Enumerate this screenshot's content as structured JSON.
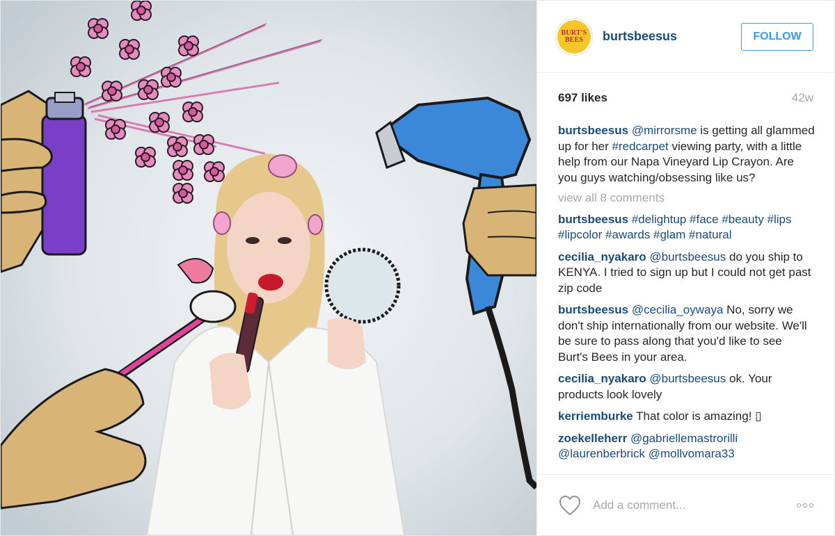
{
  "post": {
    "image_alt": "Woman in hair rollers and bathrobe holding a lip crayon, surrounded by illustrated hands with hairspray, hair dryer and makeup brush",
    "colors": {
      "link": "#1b4a78",
      "follow_blue": "#3897f0",
      "muted": "#a5a7aa",
      "avatar_yellow": "#f7c72a",
      "avatar_red": "#b5302a"
    }
  },
  "header": {
    "avatar_text": "BURT'S BEES",
    "username": "burtsbeesus",
    "follow_label": "FOLLOW"
  },
  "meta": {
    "likes": "697 likes",
    "time": "42w"
  },
  "caption": {
    "user": "burtsbeesus",
    "mention": "@mirrorsme",
    "text1": " is getting all glammed up for her ",
    "hashtag": "#redcarpet",
    "text2": " viewing party, with a little help from our Napa Vineyard Lip Crayon. Are you guys watching/obsessing like us?"
  },
  "view_all": "view all 8 comments",
  "comments": [
    {
      "user": "burtsbeesus",
      "tags": "#delightup #face #beauty #lips #lipcolor #awards #glam #natural",
      "text": ""
    },
    {
      "user": "cecilia_nyakaro",
      "tags": "@burtsbeesus",
      "text": " do you ship to KENYA. I tried to sign up but I could not get past zip code"
    },
    {
      "user": "burtsbeesus",
      "tags": "@cecilia_oywaya",
      "text": " No, sorry we don't ship internationally from our website. We'll be sure to pass along that you'd like to see Burt's Bees in your area."
    },
    {
      "user": "cecilia_nyakaro",
      "tags": "@burtsbeesus",
      "text": " ok. Your products look lovely"
    },
    {
      "user": "kerriemburke",
      "tags": "",
      "text": " That color is amazing! ▯"
    },
    {
      "user": "zoekelleherr",
      "tags": "@gabriellemastrorilli @laurenberbrick @mollvomara33",
      "text": ""
    }
  ],
  "footer": {
    "heart_icon": "heart-outline-icon",
    "add_comment_placeholder": "Add a comment...",
    "more_icon": "ellipsis-icon"
  }
}
